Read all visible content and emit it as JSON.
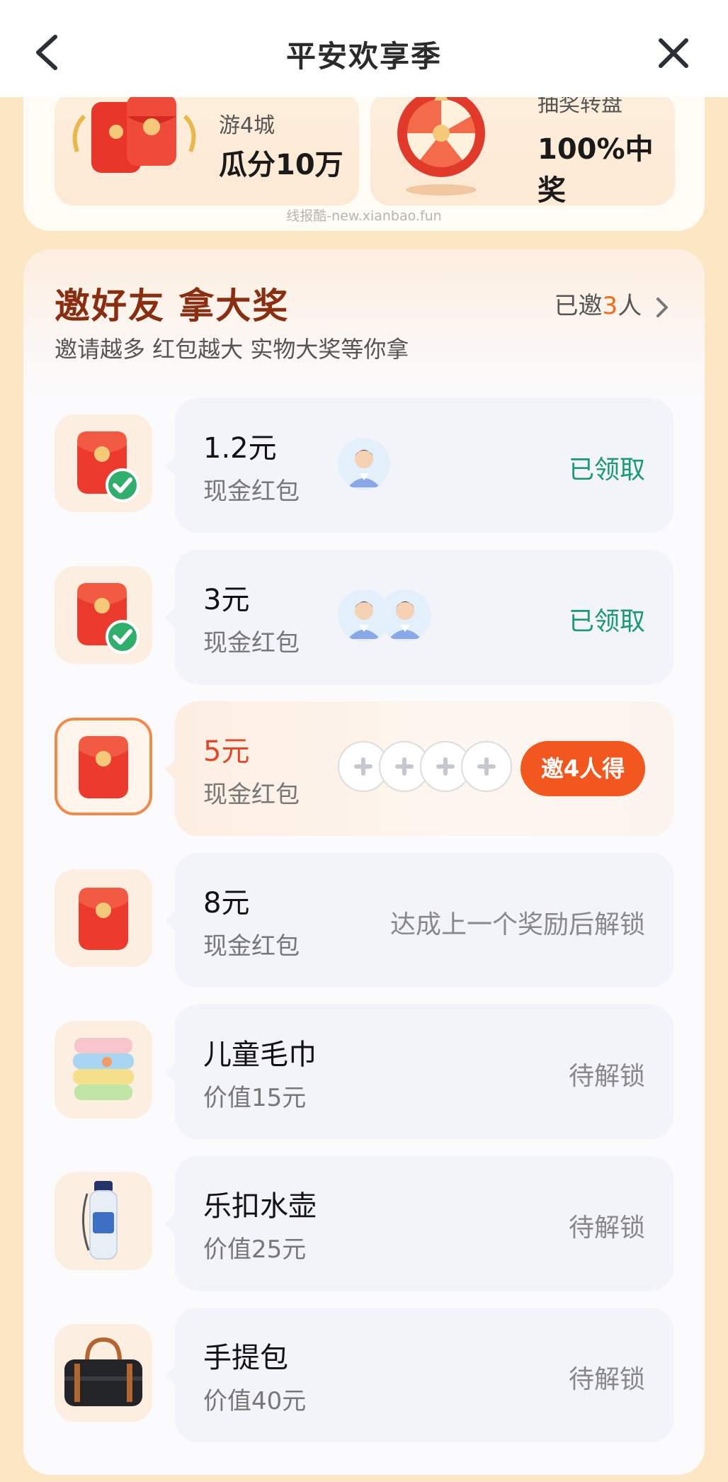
{
  "header": {
    "title": "平安欢享季",
    "back_icon": "chevron-left-icon",
    "close_icon": "close-icon"
  },
  "promo": {
    "tiles": [
      {
        "sub": "游4城",
        "main": "瓜分10万"
      },
      {
        "sub": "抽奖转盘",
        "main": "100%中奖"
      }
    ],
    "watermark": "线报酷-new.xianbao.fun"
  },
  "invite": {
    "title": "邀好友 拿大奖",
    "subtitle": "邀请越多 红包越大 实物大奖等你拿",
    "count_prefix": "已邀",
    "count": "3",
    "count_suffix": "人",
    "colors": {
      "accent": "#f2571f",
      "claimed": "#1a9a6e",
      "title": "#8a2e12"
    },
    "rewards": [
      {
        "name": "1.2元",
        "desc": "现金红包",
        "status": "已领取",
        "state": "claimed",
        "invitees": 1,
        "icon": "red-envelope-icon"
      },
      {
        "name": "3元",
        "desc": "现金红包",
        "status": "已领取",
        "state": "claimed",
        "invitees": 2,
        "icon": "red-envelope-icon"
      },
      {
        "name": "5元",
        "desc": "现金红包",
        "action": "邀4人得",
        "state": "active",
        "slots": 4,
        "icon": "red-envelope-icon"
      },
      {
        "name": "8元",
        "desc": "现金红包",
        "status": "达成上一个奖励后解锁",
        "state": "locked",
        "icon": "red-envelope-icon"
      },
      {
        "name": "儿童毛巾",
        "desc": "价值15元",
        "status": "待解锁",
        "state": "locked",
        "icon": "towel-icon"
      },
      {
        "name": "乐扣水壶",
        "desc": "价值25元",
        "status": "待解锁",
        "state": "locked",
        "icon": "water-bottle-icon"
      },
      {
        "name": "手提包",
        "desc": "价值40元",
        "status": "待解锁",
        "state": "locked",
        "icon": "handbag-icon"
      }
    ]
  }
}
